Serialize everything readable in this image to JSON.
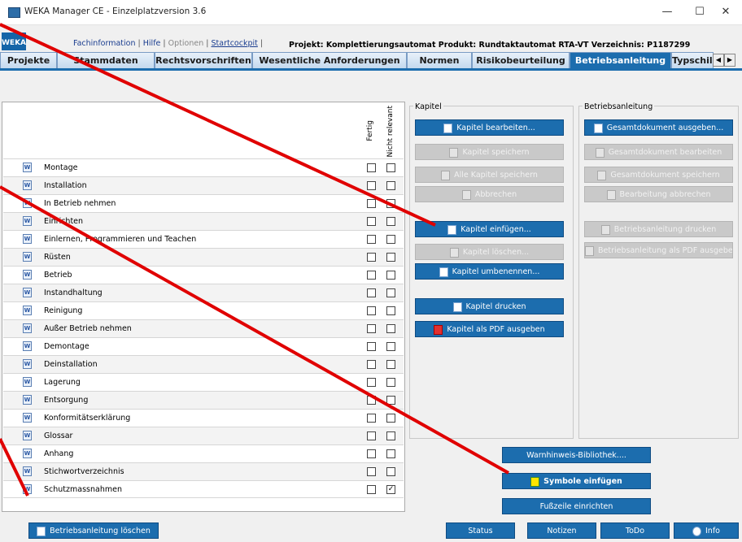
{
  "window": {
    "title": "WEKA Manager CE - Einzelplatzversion 3.6",
    "minimize": "—",
    "maximize": "☐",
    "close": "✕"
  },
  "logo": "WEKA",
  "links": {
    "fachinfo": "Fachinformation",
    "hilfe": "Hilfe",
    "optionen": "Optionen",
    "startcockpit": "Startcockpit",
    "sep": "|"
  },
  "projinfo": "Projekt: Komplettierungsautomat   Produkt: Rundtaktautomat RTA-VT   Verzeichnis: P1187299",
  "tabs": [
    "Projekte",
    "Stammdaten",
    "Rechtsvorschriften",
    "Wesentliche Anforderungen",
    "Normen",
    "Risikobeurteilung",
    "Betriebsanleitung",
    "Typschild"
  ],
  "active_tab": "Betriebsanleitung",
  "columns": {
    "fertig": "Fertig",
    "nicht_relevant": "Nicht relevant"
  },
  "chapters": [
    {
      "label": "Montage",
      "fertig": false,
      "nr": false
    },
    {
      "label": "Installation",
      "fertig": false,
      "nr": false
    },
    {
      "label": "In Betrieb nehmen",
      "fertig": false,
      "nr": false
    },
    {
      "label": "Einrichten",
      "fertig": false,
      "nr": false
    },
    {
      "label": "Einlernen, Programmieren und Teachen",
      "fertig": false,
      "nr": false
    },
    {
      "label": "Rüsten",
      "fertig": false,
      "nr": false
    },
    {
      "label": "Betrieb",
      "fertig": false,
      "nr": false
    },
    {
      "label": "Instandhaltung",
      "fertig": false,
      "nr": false
    },
    {
      "label": "Reinigung",
      "fertig": false,
      "nr": false
    },
    {
      "label": "Außer Betrieb nehmen",
      "fertig": false,
      "nr": false
    },
    {
      "label": "Demontage",
      "fertig": false,
      "nr": false
    },
    {
      "label": "Deinstallation",
      "fertig": false,
      "nr": false
    },
    {
      "label": "Lagerung",
      "fertig": false,
      "nr": false
    },
    {
      "label": "Entsorgung",
      "fertig": false,
      "nr": false
    },
    {
      "label": "Konformitätserklärung",
      "fertig": false,
      "nr": false
    },
    {
      "label": "Glossar",
      "fertig": false,
      "nr": false
    },
    {
      "label": "Anhang",
      "fertig": false,
      "nr": false
    },
    {
      "label": "Stichwortverzeichnis",
      "fertig": false,
      "nr": false
    },
    {
      "label": "Schutzmassnahmen",
      "fertig": false,
      "nr": true
    }
  ],
  "kapitel": {
    "title": "Kapitel",
    "bearbeiten": "Kapitel bearbeiten...",
    "speichern": "Kapitel speichern",
    "alle_speichern": "Alle Kapitel speichern",
    "abbrechen": "Abbrechen",
    "einfuegen": "Kapitel einfügen...",
    "loeschen": "Kapitel löschen...",
    "umbenennen": "Kapitel umbenennen...",
    "drucken": "Kapitel drucken",
    "pdf": "Kapitel als PDF ausgeben"
  },
  "betriebsanleitung": {
    "title": "Betriebsanleitung",
    "gesamt_ausgeben": "Gesamtdokument ausgeben...",
    "gesamt_bearbeiten": "Gesamtdokument bearbeiten",
    "gesamt_speichern": "Gesamtdokument speichern",
    "bearbeitung_abbrechen": "Bearbeitung abbrechen",
    "drucken": "Betriebsanleitung drucken",
    "pdf": "Betriebsanleitung als PDF ausgeben"
  },
  "extras": {
    "warnhinweis": "Warnhinweis-Bibliothek....",
    "symbole": "Symbole einfügen",
    "fusszeile": "Fußzeile einrichten"
  },
  "bottom": {
    "loeschen": "Betriebsanleitung löschen",
    "status": "Status",
    "notizen": "Notizen",
    "todo": "ToDo",
    "info": "Info"
  },
  "colors": {
    "accent": "#1c6dae",
    "annotation": "#e00000"
  }
}
